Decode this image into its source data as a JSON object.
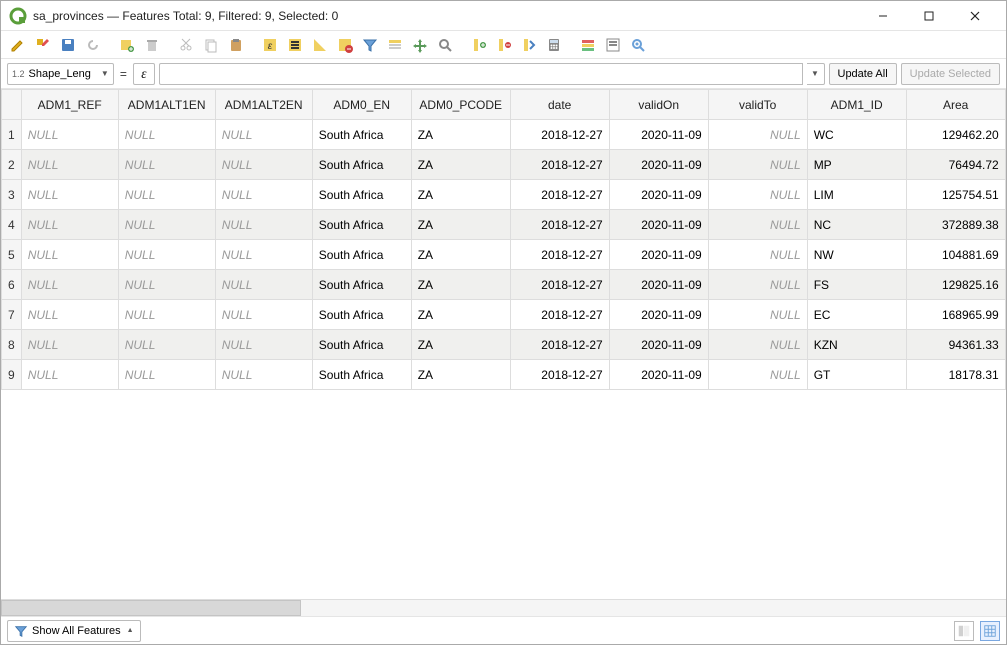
{
  "title": "sa_provinces — Features Total: 9, Filtered: 9, Selected: 0",
  "field_selector": {
    "type": "1.2",
    "name": "Shape_Leng"
  },
  "eq": "=",
  "epsilon": "ε",
  "expr_value": "",
  "update_all": "Update All",
  "update_selected": "Update Selected",
  "columns": [
    "ADM1_REF",
    "ADM1ALT1EN",
    "ADM1ALT2EN",
    "ADM0_EN",
    "ADM0_PCODE",
    "date",
    "validOn",
    "validTo",
    "ADM1_ID",
    "Area"
  ],
  "rows": [
    {
      "n": "1",
      "ref": null,
      "a1": null,
      "a2": null,
      "a0en": "South Africa",
      "pcode": "ZA",
      "date": "2018-12-27",
      "valon": "2020-11-09",
      "valto": null,
      "id": "WC",
      "area": "129462.20"
    },
    {
      "n": "2",
      "ref": null,
      "a1": null,
      "a2": null,
      "a0en": "South Africa",
      "pcode": "ZA",
      "date": "2018-12-27",
      "valon": "2020-11-09",
      "valto": null,
      "id": "MP",
      "area": "76494.72"
    },
    {
      "n": "3",
      "ref": null,
      "a1": null,
      "a2": null,
      "a0en": "South Africa",
      "pcode": "ZA",
      "date": "2018-12-27",
      "valon": "2020-11-09",
      "valto": null,
      "id": "LIM",
      "area": "125754.51"
    },
    {
      "n": "4",
      "ref": null,
      "a1": null,
      "a2": null,
      "a0en": "South Africa",
      "pcode": "ZA",
      "date": "2018-12-27",
      "valon": "2020-11-09",
      "valto": null,
      "id": "NC",
      "area": "372889.38"
    },
    {
      "n": "5",
      "ref": null,
      "a1": null,
      "a2": null,
      "a0en": "South Africa",
      "pcode": "ZA",
      "date": "2018-12-27",
      "valon": "2020-11-09",
      "valto": null,
      "id": "NW",
      "area": "104881.69"
    },
    {
      "n": "6",
      "ref": null,
      "a1": null,
      "a2": null,
      "a0en": "South Africa",
      "pcode": "ZA",
      "date": "2018-12-27",
      "valon": "2020-11-09",
      "valto": null,
      "id": "FS",
      "area": "129825.16"
    },
    {
      "n": "7",
      "ref": null,
      "a1": null,
      "a2": null,
      "a0en": "South Africa",
      "pcode": "ZA",
      "date": "2018-12-27",
      "valon": "2020-11-09",
      "valto": null,
      "id": "EC",
      "area": "168965.99"
    },
    {
      "n": "8",
      "ref": null,
      "a1": null,
      "a2": null,
      "a0en": "South Africa",
      "pcode": "ZA",
      "date": "2018-12-27",
      "valon": "2020-11-09",
      "valto": null,
      "id": "KZN",
      "area": "94361.33"
    },
    {
      "n": "9",
      "ref": null,
      "a1": null,
      "a2": null,
      "a0en": "South Africa",
      "pcode": "ZA",
      "date": "2018-12-27",
      "valon": "2020-11-09",
      "valto": null,
      "id": "GT",
      "area": "18178.31"
    }
  ],
  "null_text": "NULL",
  "show_all": "Show All Features"
}
